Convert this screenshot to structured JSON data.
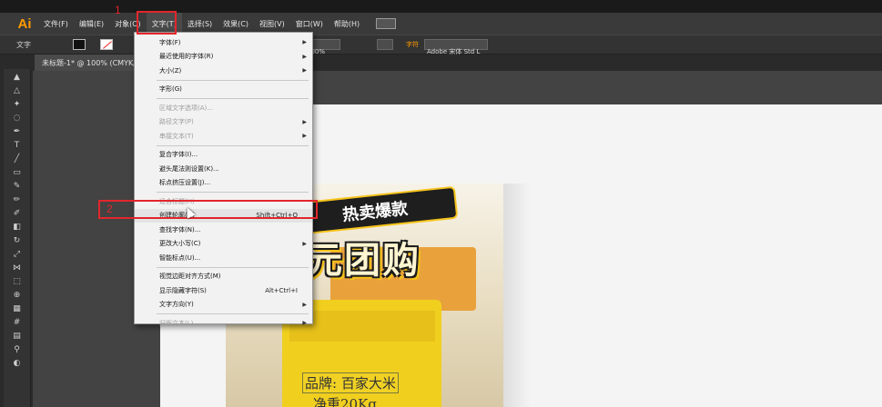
{
  "app": {
    "logo": "Ai",
    "document_tab": "未标题-1* @ 100% (CMYK/..."
  },
  "menubar": {
    "items": [
      "文件(F)",
      "编辑(E)",
      "对象(O)",
      "文字(T)",
      "选择(S)",
      "效果(C)",
      "视图(V)",
      "窗口(W)",
      "帮助(H)"
    ]
  },
  "options_bar": {
    "label": "文字",
    "zoom": "100%",
    "font_hint": "字符",
    "font_name": "Adobe 宋体 Std L"
  },
  "dropdown": {
    "items": [
      {
        "label": "字体(F)",
        "arrow": true,
        "disabled": false
      },
      {
        "label": "最近使用的字体(R)",
        "arrow": true,
        "disabled": false
      },
      {
        "label": "大小(Z)",
        "arrow": true,
        "disabled": false
      },
      {
        "sep": true
      },
      {
        "label": "字形(G)",
        "disabled": false
      },
      {
        "sep": true
      },
      {
        "label": "区域文字选项(A)...",
        "disabled": true
      },
      {
        "label": "路径文字(P)",
        "arrow": true,
        "disabled": true
      },
      {
        "label": "串接文本(T)",
        "arrow": true,
        "disabled": true
      },
      {
        "sep": true
      },
      {
        "label": "复合字体(I)...",
        "disabled": false
      },
      {
        "label": "避头尾法则设置(K)...",
        "disabled": false
      },
      {
        "label": "标点挤压设置(J)...",
        "disabled": false
      },
      {
        "sep": true
      },
      {
        "label": "适合标题(H)",
        "disabled": true
      },
      {
        "label": "创建轮廓(O)",
        "shortcut": "Shift+Ctrl+O",
        "disabled": false,
        "highlight": true
      },
      {
        "label": "查找字体(N)...",
        "disabled": false
      },
      {
        "label": "更改大小写(C)",
        "arrow": true,
        "disabled": false
      },
      {
        "label": "智能标点(U)...",
        "disabled": false
      },
      {
        "sep": true
      },
      {
        "label": "视觉边距对齐方式(M)",
        "disabled": false
      },
      {
        "label": "显示隐藏字符(S)",
        "shortcut": "Alt+Ctrl+I",
        "disabled": false
      },
      {
        "label": "文字方向(Y)",
        "arrow": true,
        "disabled": false
      },
      {
        "sep": true
      },
      {
        "label": "旧版文本(L)",
        "arrow": true,
        "disabled": true
      }
    ]
  },
  "annotations": {
    "step1": "1",
    "step2": "2",
    "color": "#e2262b"
  },
  "artwork": {
    "badge": "热卖爆款",
    "title": "元团购",
    "brand": "品牌: 百家大米",
    "net": "净重20Kg"
  },
  "colors": {
    "menubar": "#3a3a3a",
    "dropdown_bg": "#f2f2f2",
    "ai_orange": "#ff9a00",
    "bag_yellow": "#f1cf1f"
  }
}
